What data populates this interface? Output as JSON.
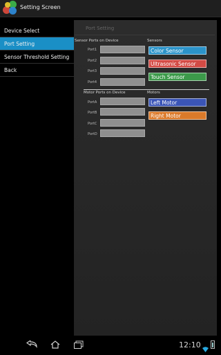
{
  "actionbar": {
    "title": "Setting Screen"
  },
  "sidebar": {
    "items": [
      {
        "label": "Device Select"
      },
      {
        "label": "Port Setting"
      },
      {
        "label": "Sensor Threshold Setting"
      },
      {
        "label": "Back"
      }
    ]
  },
  "panel": {
    "title": "Port Setting",
    "sensor_ports": {
      "heading": "Sensor Ports on Device",
      "ports": [
        "Port1",
        "Port2",
        "Port3",
        "Port4"
      ]
    },
    "sensors": {
      "heading": "Sensors",
      "items": [
        {
          "label": "Color Sensor",
          "color": "#2b93c9"
        },
        {
          "label": "Ultrasonic Sensor",
          "color": "#d34b45"
        },
        {
          "label": "Touch Sensor",
          "color": "#3c9a4a"
        }
      ]
    },
    "motor_ports": {
      "heading": "Motor Ports on Device",
      "ports": [
        "PortA",
        "PortB",
        "PortC",
        "PortD"
      ]
    },
    "motors": {
      "heading": "Motors",
      "items": [
        {
          "label": "Left Motor",
          "color": "#3b55b7"
        },
        {
          "label": "Right Motor",
          "color": "#db7a2a"
        }
      ]
    }
  },
  "statusbar": {
    "time": "12:10"
  }
}
